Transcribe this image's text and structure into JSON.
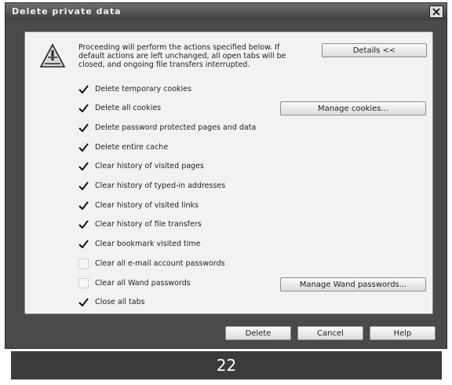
{
  "dialog": {
    "title": "Delete private data",
    "intro": "Proceeding will perform the actions specified below. If default actions are left unchanged, all open tabs will be closed, and ongoing file transfers interrupted.",
    "details_button": "Details <<",
    "manage_cookies_button": "Manage cookies...",
    "manage_wand_button": "Manage Wand passwords...",
    "options": [
      {
        "label": "Delete temporary cookies",
        "checked": true
      },
      {
        "label": "Delete all cookies",
        "checked": true
      },
      {
        "label": "Delete password protected pages and data",
        "checked": true
      },
      {
        "label": "Delete entire cache",
        "checked": true
      },
      {
        "label": "Clear history of visited pages",
        "checked": true
      },
      {
        "label": "Clear history of typed-in addresses",
        "checked": true
      },
      {
        "label": "Clear history of visited links",
        "checked": true
      },
      {
        "label": "Clear history of file transfers",
        "checked": true
      },
      {
        "label": "Clear bookmark visited time",
        "checked": true
      },
      {
        "label": "Clear all e-mail account passwords",
        "checked": false
      },
      {
        "label": "Clear all Wand passwords",
        "checked": false
      },
      {
        "label": "Close all tabs",
        "checked": true
      }
    ],
    "footer": {
      "delete": "Delete",
      "cancel": "Cancel",
      "help": "Help"
    }
  },
  "page_number": "22",
  "icons": {
    "close": "close-icon",
    "warning": "warning-icon",
    "check": "checkmark-icon"
  }
}
